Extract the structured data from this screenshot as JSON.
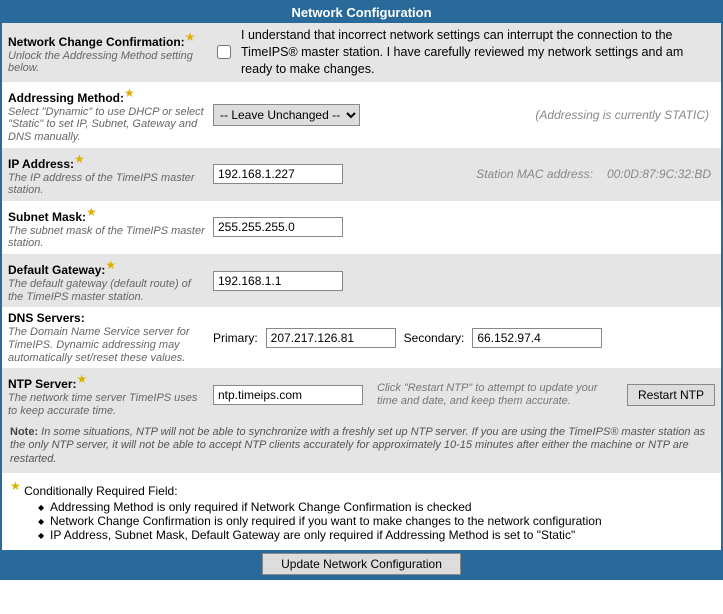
{
  "title": "Network Configuration",
  "rows": {
    "confirm": {
      "label": "Network Change Confirmation:",
      "desc": "Unlock the Addressing Method setting below.",
      "text": "I understand that incorrect network settings can interrupt the connection to the TimeIPS® master station. I have carefully reviewed my network settings and am ready to make changes."
    },
    "addressing": {
      "label": "Addressing Method:",
      "desc": "Select \"Dynamic\" to use DHCP or select \"Static\" to set IP, Subnet, Gateway and DNS manually.",
      "selected": "-- Leave Unchanged --",
      "note": "(Addressing is currently STATIC)"
    },
    "ip": {
      "label": "IP Address:",
      "desc": "The IP address of the TimeIPS master station.",
      "value": "192.168.1.227",
      "mac_label": "Station MAC address:",
      "mac_value": "00:0D:87:9C:32:BD"
    },
    "subnet": {
      "label": "Subnet Mask:",
      "desc": "The subnet mask of the TimeIPS master station.",
      "value": "255.255.255.0"
    },
    "gateway": {
      "label": "Default Gateway:",
      "desc": "The default gateway (default route) of the TimeIPS master station.",
      "value": "192.168.1.1"
    },
    "dns": {
      "label": "DNS Servers:",
      "desc": "The Domain Name Service server for TimeIPS. Dynamic addressing may automatically set/reset these values.",
      "primary_lbl": "Primary:",
      "primary_val": "207.217.126.81",
      "secondary_lbl": "Secondary:",
      "secondary_val": "66.152.97.4"
    },
    "ntp": {
      "label": "NTP Server:",
      "desc": "The network time server TimeIPS uses to keep accurate time.",
      "value": "ntp.timeips.com",
      "hint": "Click \"Restart NTP\" to attempt to update your time and date, and keep them accurate.",
      "button": "Restart NTP"
    }
  },
  "note": {
    "lead": "Note:",
    "body": "In some situations, NTP will not be able to synchronize with a freshly set up NTP server. If you are using the TimeIPS® master station as the only NTP server, it will not be able to accept NTP clients accurately for approximately 10-15 minutes after either the machine or NTP are restarted."
  },
  "footnote": {
    "heading": "Conditionally Required Field:",
    "items": [
      "Addressing Method is only required if Network Change Confirmation is checked",
      "Network Change Confirmation is only required if you want to make changes to the network configuration",
      "IP Address, Subnet Mask, Default Gateway are only required if Addressing Method is set to \"Static\""
    ]
  },
  "submit": "Update Network Configuration"
}
